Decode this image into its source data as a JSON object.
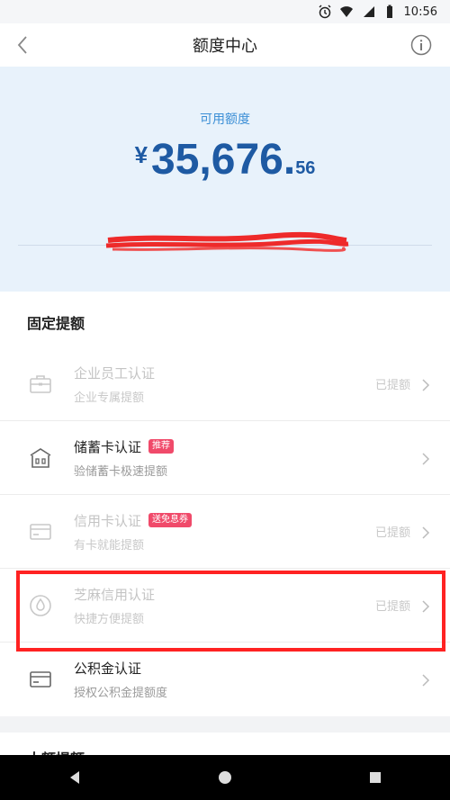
{
  "status_bar": {
    "time": "10:56",
    "icons": [
      "alarm-icon",
      "wifi-icon",
      "signal-icon",
      "battery-icon"
    ]
  },
  "nav": {
    "title": "额度中心",
    "back_icon": "chevron-left-icon",
    "info_icon": "info-icon"
  },
  "hero": {
    "label": "可用额度",
    "currency": "¥",
    "amount_main": "35,676.",
    "amount_decimal": "56"
  },
  "fixed_section": {
    "title": "固定提额",
    "items": [
      {
        "title": "企业员工认证",
        "subtitle": "企业专属提额",
        "status": "已提额",
        "icon": "briefcase-icon",
        "state": "done"
      },
      {
        "title": "储蓄卡认证",
        "subtitle": "验储蓄卡极速提额",
        "badge": "推荐",
        "icon": "bank-building-icon",
        "state": "available"
      },
      {
        "title": "信用卡认证",
        "subtitle": "有卡就能提额",
        "badge": "送免息券",
        "status": "已提额",
        "icon": "credit-card-icon",
        "state": "done"
      },
      {
        "title": "芝麻信用认证",
        "subtitle": "快捷方便提额",
        "status": "已提额",
        "icon": "sesame-icon",
        "state": "done"
      },
      {
        "title": "公积金认证",
        "subtitle": "授权公积金提额度",
        "icon": "fund-card-icon",
        "state": "available"
      }
    ]
  },
  "next_section": {
    "title": "大额提额"
  },
  "colors": {
    "accent": "#1e5aa3",
    "hero_bg": "#e8f2fb",
    "badge": "#f04a6a",
    "highlight": "#ff2222"
  }
}
